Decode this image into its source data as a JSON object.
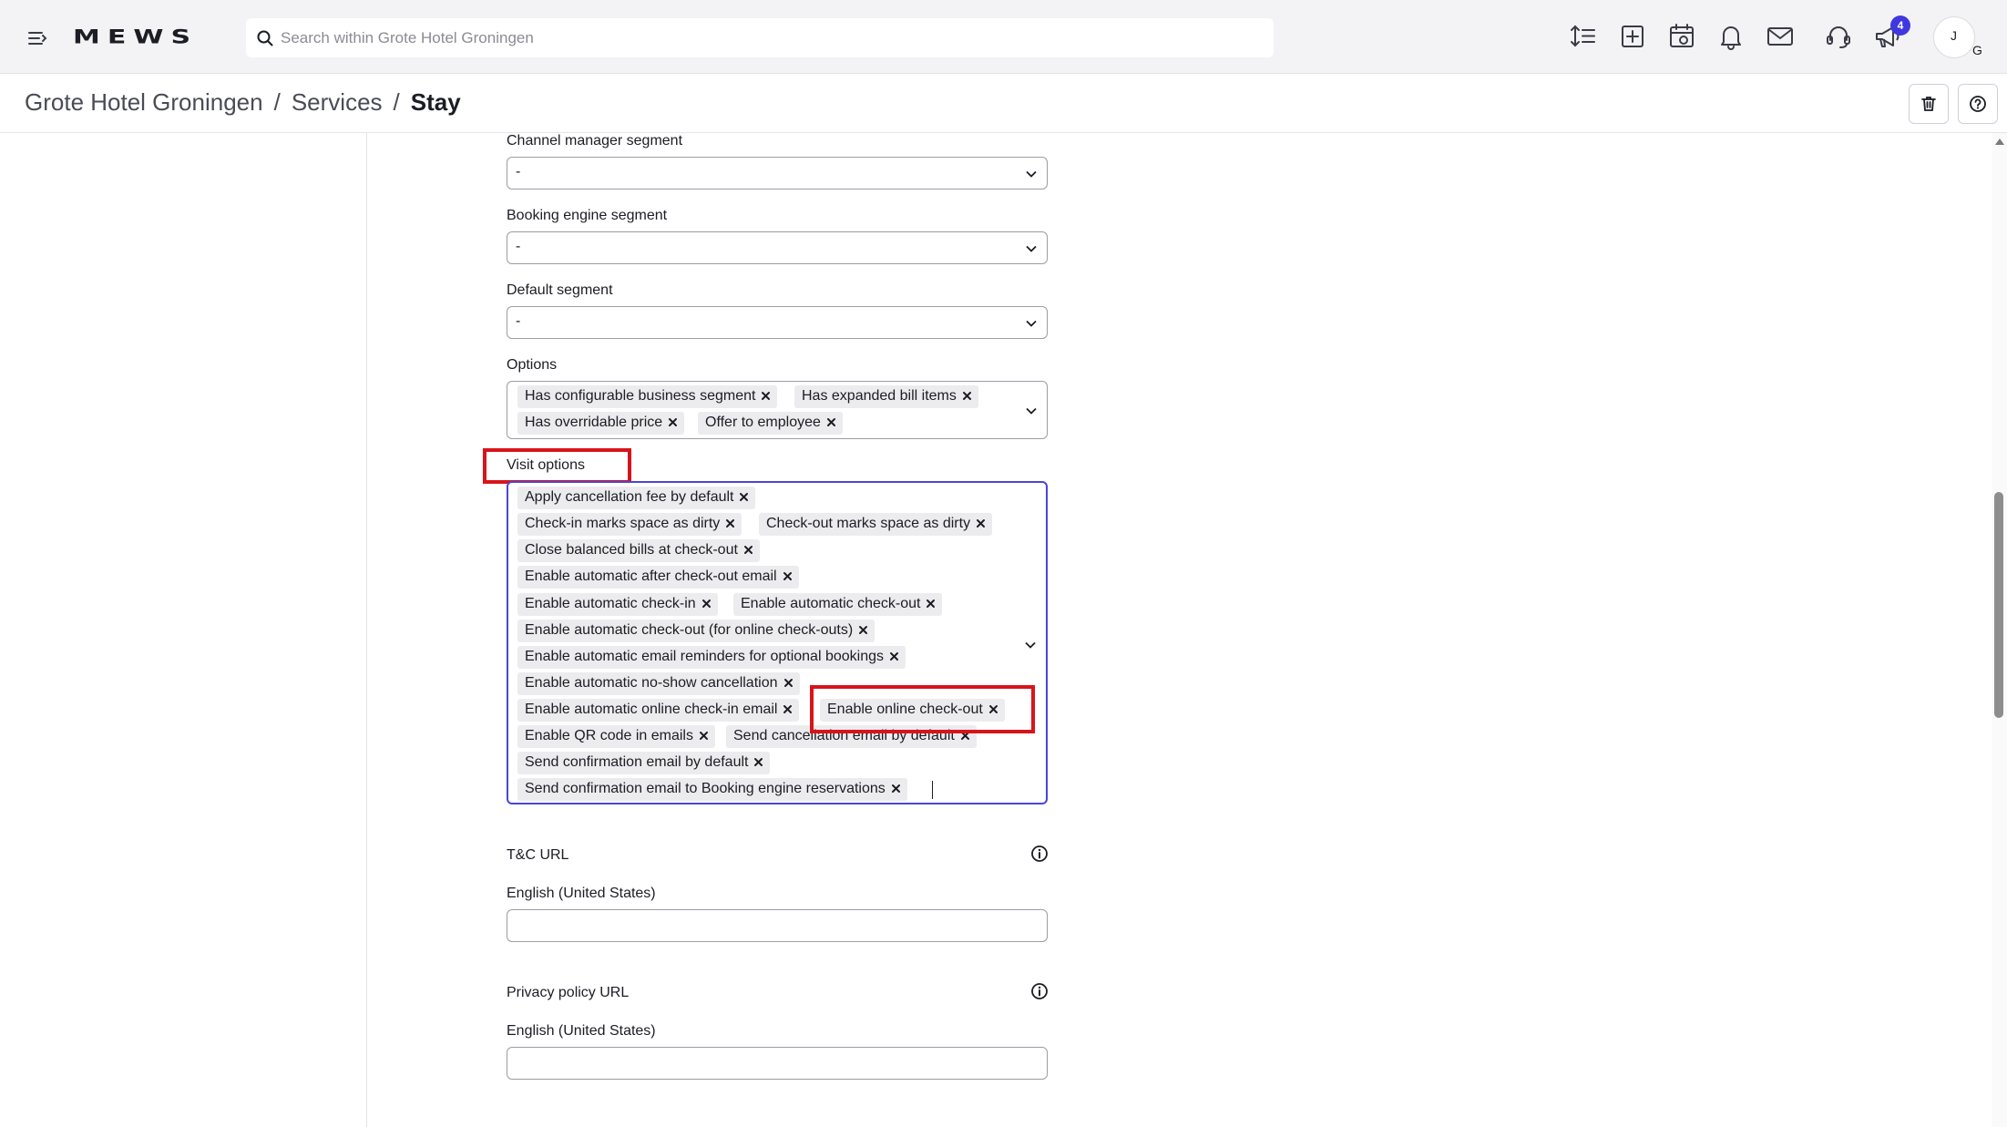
{
  "topbar": {
    "logo_text": "MEWS",
    "search_placeholder": "Search within Grote Hotel Groningen",
    "notification_count": "4",
    "avatar_initials": [
      "J",
      "G"
    ],
    "accent_color": "#3f38e0"
  },
  "breadcrumb": {
    "items": [
      "Grote Hotel Groningen",
      "Services"
    ],
    "current": "Stay",
    "separator": "/"
  },
  "form": {
    "channel_manager_segment": {
      "label": "Channel manager segment",
      "value": "-"
    },
    "booking_engine_segment": {
      "label": "Booking engine segment",
      "value": "-"
    },
    "default_segment": {
      "label": "Default segment",
      "value": "-"
    },
    "options": {
      "label": "Options",
      "chips": [
        "Has configurable business segment",
        "Has expanded bill items",
        "Has overridable price",
        "Offer to employee"
      ]
    },
    "visit_options": {
      "label": "Visit options",
      "chips": [
        "Apply cancellation fee by default",
        "Check-in marks space as dirty",
        "Check-out marks space as dirty",
        "Close balanced bills at check-out",
        "Enable automatic after check-out email",
        "Enable automatic check-in",
        "Enable automatic check-out",
        "Enable automatic check-out (for online check-outs)",
        "Enable automatic email reminders for optional bookings",
        "Enable automatic no-show cancellation",
        "Enable automatic online check-in email",
        "Enable online check-out",
        "Enable QR code in emails",
        "Send cancellation email by default",
        "Send confirmation email by default",
        "Send confirmation email to Booking engine reservations"
      ]
    },
    "tc_url": {
      "label": "T&C URL",
      "language_label": "English (United States)",
      "value": ""
    },
    "privacy_url": {
      "label": "Privacy policy URL",
      "language_label": "English (United States)",
      "value": ""
    }
  },
  "highlight_color": "#d8141b",
  "icons": [
    "menu-icon",
    "search-icon",
    "sort-icon",
    "add-icon",
    "calendar-icon",
    "bell-icon",
    "mail-icon",
    "headset-icon",
    "megaphone-icon",
    "trash-icon",
    "help-icon",
    "chevron-down-icon",
    "info-icon",
    "close-icon"
  ]
}
